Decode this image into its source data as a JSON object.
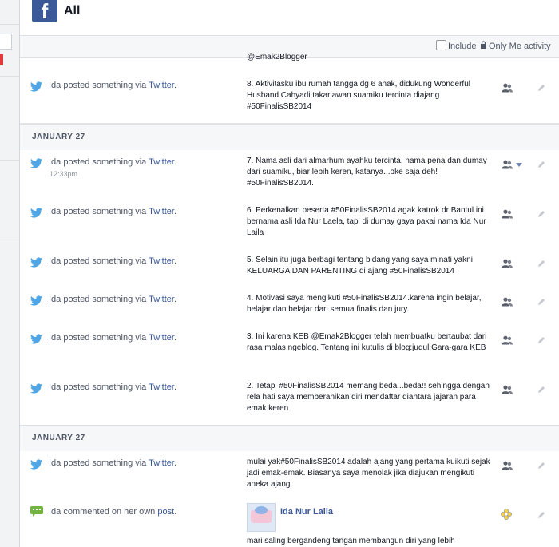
{
  "header": {
    "logo": "f",
    "title": "All"
  },
  "toolbar": {
    "include_label": "Include",
    "only_me_label": "Only Me activity"
  },
  "partial_top_text": "@Emak2Blogger",
  "dates": [
    "JANUARY 27",
    "JANUARY 27"
  ],
  "rows": [
    {
      "actor": "Ida posted something via ",
      "link": "Twitter",
      "suffix": ".",
      "time": "",
      "text": "8. Aktivitasku ibu rumah tangga dg 6 anak, didukung Wonderful Husband Cahyadi takariawan suamiku tercinta diajang #50FinalisSB2014"
    },
    {
      "actor": "Ida posted something via ",
      "link": "Twitter",
      "suffix": ".",
      "time": "12:33pm",
      "text": "7. Nama asli dari almarhum ayahku tercinta, nama pena dan dumay dari suamiku, biar lebih keren, katanya...oke saja deh! #50FinalisSB2014."
    },
    {
      "actor": "Ida posted something via ",
      "link": "Twitter",
      "suffix": ".",
      "time": "",
      "text": "6. Perkenalkan peserta #50FinalisSB2014 agak katrok dr Bantul ini bernama asli Ida Nur Laela, tapi di dumay gaya pakai nama Ida Nur Laila"
    },
    {
      "actor": "Ida posted something via ",
      "link": "Twitter",
      "suffix": ".",
      "time": "",
      "text": "5. Selain itu juga berbagi tentang bidang yang saya minati yakni KELUARGA DAN PARENTING di ajang #50FinalisSB2014"
    },
    {
      "actor": "Ida posted something via ",
      "link": "Twitter",
      "suffix": ".",
      "time": "",
      "text": "4. Motivasi saya mengikuti  #50FinalisSB2014.karena ingin belajar, belajar dan belajar dari semua finalis dan jury."
    },
    {
      "actor": "Ida posted something via ",
      "link": "Twitter",
      "suffix": ".",
      "time": "",
      "text": "3. Ini karena KEB @Emak2Blogger telah membuatku bertaubat dari rasa malas ngeblog. Tentang ini kutulis di blog:judul:Gara-gara KEB"
    },
    {
      "actor": "Ida posted something via ",
      "link": "Twitter",
      "suffix": ".",
      "time": "",
      "text": "2. Tetapi #50FinalisSB2014 memang beda...beda!! sehingga dengan rela hati saya memberanikan diri mendaftar diantara jajaran para emak keren"
    },
    {
      "actor": "Ida posted something via ",
      "link": "Twitter",
      "suffix": ".",
      "time": "",
      "text": "mulai yak#50FinalisSB2014 adalah ajang yang pertama kuikuti sejak jadi emak-emak. Biasanya saya menolak jika diajukan mengikuti aneka ajang."
    }
  ],
  "comment": {
    "actor": "Ida commented on her own ",
    "link": "post",
    "suffix": ".",
    "poster": "Ida Nur Laila",
    "text": "mari saling bergandeng tangan membangun diri yang lebih"
  },
  "colors": {
    "brand": "#3b5998",
    "twitter": "#4ea6e6",
    "comment": "#72b342"
  },
  "icons": [
    "facebook-logo-icon",
    "twitter-bird-icon",
    "audience-friends-icon",
    "pencil-icon",
    "lock-icon",
    "comment-icon",
    "custom-audience-icon",
    "caret-down-icon"
  ]
}
